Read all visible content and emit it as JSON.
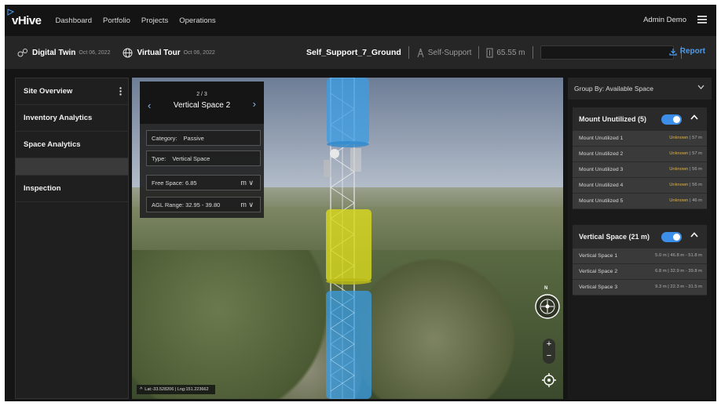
{
  "nav": {
    "logo": "vHive",
    "items": [
      "Dashboard",
      "Portfolio",
      "Projects",
      "Operations"
    ],
    "user": "Admin Demo"
  },
  "subbar": {
    "digital_twin": {
      "title": "Digital Twin",
      "date": "Oct 06, 2022"
    },
    "virtual_tour": {
      "title": "Virtual Tour",
      "date": "Oct 06, 2022"
    },
    "asset_name": "Self_Support_7_Ground",
    "asset_type": "Self-Support",
    "asset_height": "65.55 m",
    "report": "Report"
  },
  "sidebar": {
    "items": [
      {
        "label": "Site Overview"
      },
      {
        "label": "Inventory Analytics"
      },
      {
        "label": "Space Analytics"
      },
      {
        "label": ""
      },
      {
        "label": "Inspection"
      }
    ]
  },
  "viewer": {
    "pager": "2 / 3",
    "title": "Vertical Space 2",
    "category_label": "Category:",
    "category_value": "Passive",
    "type_label": "Type:",
    "type_value": "Vertical Space",
    "free_space": "Free Space: 6.85",
    "agl_range": "AGL Range: 32.95 - 39.80",
    "unit": "m",
    "coords": "Lat:-33.528206 | Lng:151.223662",
    "compass_n": "N",
    "zoom_in": "+",
    "zoom_out": "−"
  },
  "right_panel": {
    "group_by": "Group By: Available Space",
    "sections": [
      {
        "title": "Mount Unutilized (5)",
        "toggle_on": true,
        "rows": [
          {
            "name": "Mount Unutilized 1",
            "status": "Unknown",
            "value": "57 m"
          },
          {
            "name": "Mount Unutilized 2",
            "status": "Unknown",
            "value": "57 m"
          },
          {
            "name": "Mount Unutilized 3",
            "status": "Unknown",
            "value": "56 m"
          },
          {
            "name": "Mount Unutilized 4",
            "status": "Unknown",
            "value": "56 m"
          },
          {
            "name": "Mount Unutilized 5",
            "status": "Unknown",
            "value": "46 m"
          }
        ]
      },
      {
        "title": "Vertical Space (21 m)",
        "toggle_on": true,
        "rows": [
          {
            "name": "Vertical Space 1",
            "size": "5.0 m",
            "range": "46.8 m - 51.8 m"
          },
          {
            "name": "Vertical Space 2",
            "size": "6.8 m",
            "range": "32.9 m - 39.8 m"
          },
          {
            "name": "Vertical Space 3",
            "size": "9.3 m",
            "range": "22.3 m - 31.5 m"
          }
        ]
      }
    ]
  },
  "colors": {
    "accent": "#3d8ee8",
    "report_link": "#4a9df0",
    "space_blue": "#3a9ee6",
    "space_yellow": "#d8d81e",
    "unknown_status": "#e1b23a"
  },
  "icons": [
    "menu-icon",
    "digital-twin-icon",
    "globe-icon",
    "tower-icon",
    "height-icon",
    "download-icon",
    "kebab-icon",
    "chevron-left-icon",
    "chevron-right-icon",
    "chevron-down-icon",
    "compass-icon",
    "locate-icon",
    "caret-up-icon"
  ]
}
